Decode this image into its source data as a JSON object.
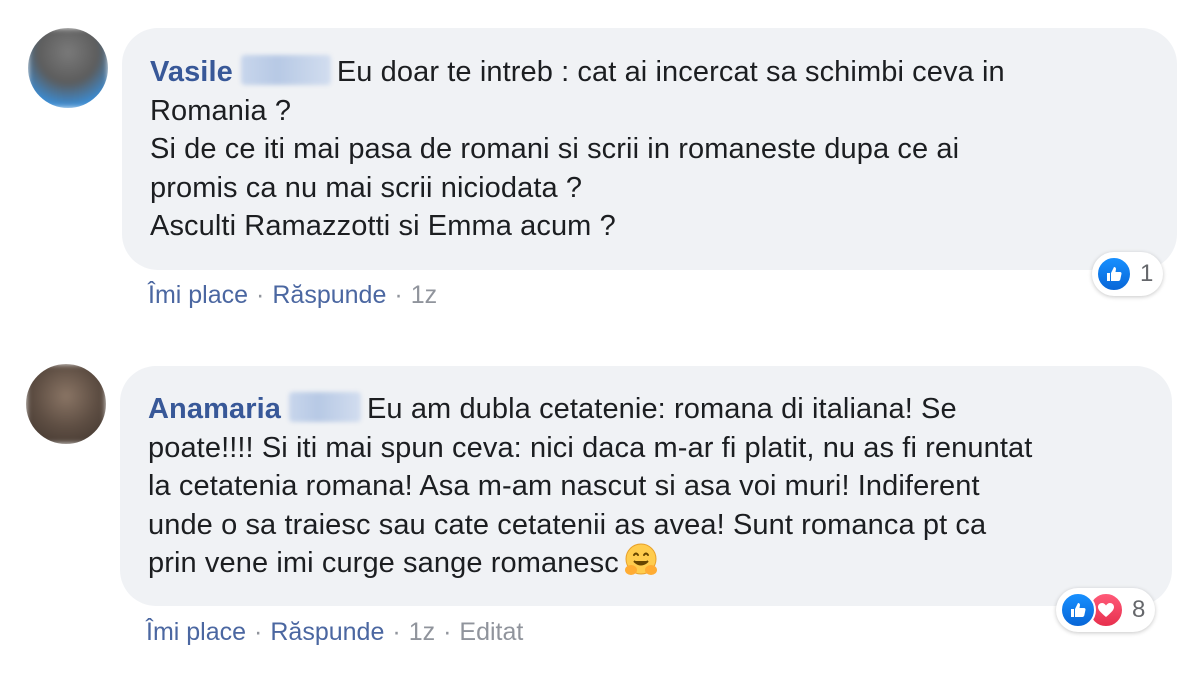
{
  "comments": [
    {
      "author": "Vasile",
      "lines": [
        "Eu doar te intreb : cat ai incercat sa schimbi ceva in",
        "Romania ?",
        "Si de ce iti mai pasa de romani si scrii in romaneste dupa ce ai",
        "promis ca nu mai scrii niciodata ?",
        "Asculti Ramazzotti si Emma acum ?"
      ],
      "actions": {
        "like": "Îmi place",
        "reply": "Răspunde",
        "time": "1z",
        "separator": "·"
      },
      "reactions": {
        "icons": [
          "like-icon"
        ],
        "count": "1"
      },
      "avatar_colors": [
        "#6b6b6b",
        "#3e8fd6"
      ]
    },
    {
      "author": "Anamaria",
      "lines": [
        "Eu am dubla cetatenie: romana di italiana! Se",
        "poate!!!! Si iti mai spun ceva: nici daca m-ar fi platit, nu as fi renuntat",
        "la cetatenia romana! Asa m-am nascut si asa voi muri! Indiferent",
        "unde o sa traiesc sau cate cetatenii as avea! Sunt romanca pt ca",
        "prin vene imi curge sange romanesc"
      ],
      "emoji": "hugging-face-emoji",
      "actions": {
        "like": "Îmi place",
        "reply": "Răspunde",
        "time": "1z",
        "edited": "Editat",
        "separator": "·"
      },
      "reactions": {
        "icons": [
          "like-icon",
          "love-icon"
        ],
        "count": "8"
      },
      "avatar_colors": [
        "#5a4a3e",
        "#9a8474"
      ]
    }
  ],
  "colors": {
    "author": "#385898",
    "bubble": "#f0f2f5",
    "action_link": "#4b67a1",
    "meta": "#90949c",
    "like": "#1877f2",
    "love": "#f33e58"
  }
}
